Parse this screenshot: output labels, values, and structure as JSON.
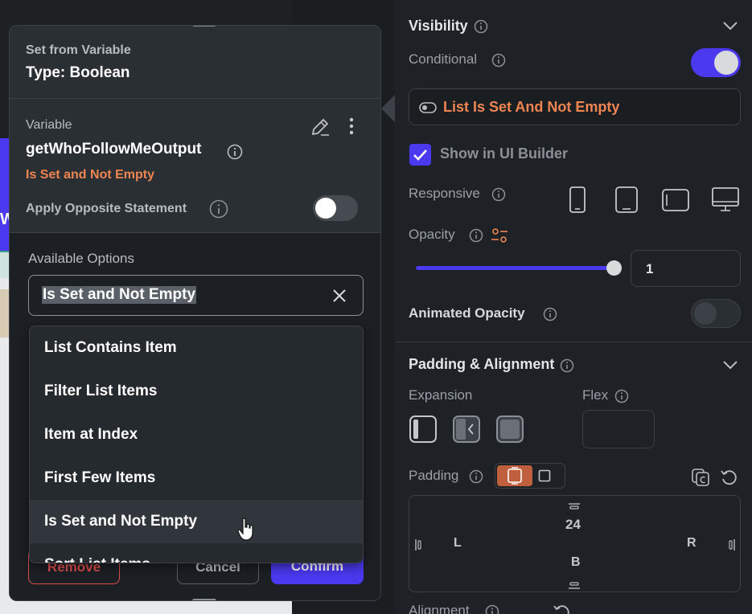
{
  "popup": {
    "header_sub": "Set from Variable",
    "header_title": "Type: Boolean",
    "variable_label": "Variable",
    "variable_name": "getWhoFollowMeOutput",
    "variable_condition": "Is Set and Not Empty",
    "apply_opposite_label": "Apply Opposite Statement",
    "apply_opposite_on": false,
    "options_label": "Available Options",
    "selected_option": "Is Set and Not Empty",
    "dropdown_items": [
      "List Contains Item",
      "Filter List Items",
      "Item at Index",
      "First Few Items",
      "Is Set and Not Empty",
      "Sort List Items"
    ],
    "hovered_item_index": 4,
    "buttons": {
      "remove": "Remove",
      "cancel": "Cancel",
      "confirm": "Confirm"
    }
  },
  "canvas": {
    "partial_letter": "W"
  },
  "panel": {
    "visibility_title": "Visibility",
    "conditional_label": "Conditional",
    "conditional_on": true,
    "condition_value": "List Is Set And Not Empty",
    "show_in_builder_label": "Show in UI Builder",
    "show_in_builder_checked": true,
    "responsive_label": "Responsive",
    "devices": [
      "phone-icon",
      "tablet-portrait-icon",
      "tablet-landscape-icon",
      "desktop-icon"
    ],
    "opacity_label": "Opacity",
    "opacity_value": "1",
    "animated_opacity_label": "Animated Opacity",
    "animated_opacity_on": false,
    "padding_alignment_title": "Padding & Alignment",
    "expansion_label": "Expansion",
    "flex_label": "Flex",
    "padding_label": "Padding",
    "padding_top": "24",
    "padding_left": "L",
    "padding_right": "R",
    "padding_bottom": "B",
    "alignment_label": "Alignment"
  },
  "colors": {
    "accent": "#4b39ef",
    "condition_text": "#ef8552",
    "danger": "#e04f50",
    "panel_bg": "#1e2226"
  }
}
